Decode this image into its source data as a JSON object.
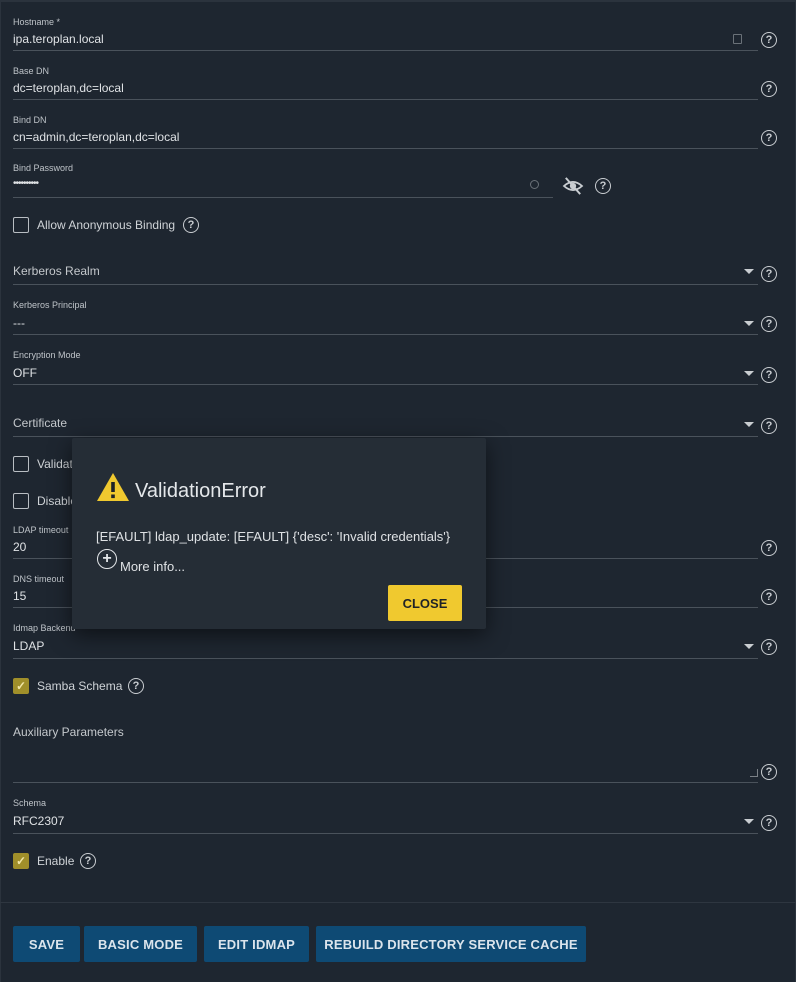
{
  "form": {
    "hostname": {
      "label": "Hostname *",
      "value": "ipa.teroplan.local"
    },
    "base_dn": {
      "label": "Base DN",
      "value": "dc=teroplan,dc=local"
    },
    "bind_dn": {
      "label": "Bind DN",
      "value": "cn=admin,dc=teroplan,dc=local"
    },
    "bind_password": {
      "label": "Bind Password",
      "value": "••••••••••"
    },
    "allow_anonymous": {
      "label": "Allow Anonymous Binding",
      "checked": false
    },
    "kerberos_realm": {
      "placeholder": "Kerberos Realm"
    },
    "kerberos_principal": {
      "label": "Kerberos Principal",
      "value": "---"
    },
    "encryption_mode": {
      "label": "Encryption Mode",
      "value": "OFF"
    },
    "certificate": {
      "placeholder": "Certificate"
    },
    "validate_certs": {
      "label": "Validat",
      "checked": false
    },
    "disable": {
      "label": "Disable",
      "checked": false
    },
    "ldap_timeout": {
      "label": "LDAP timeout",
      "value": "20"
    },
    "dns_timeout": {
      "label": "DNS timeout",
      "value": "15"
    },
    "idmap_backend": {
      "label": "Idmap Backend",
      "value": "LDAP"
    },
    "samba_schema": {
      "label": "Samba Schema",
      "checked": true
    },
    "auxiliary_parameters": {
      "label": "Auxiliary Parameters",
      "value": ""
    },
    "schema": {
      "label": "Schema",
      "value": "RFC2307"
    },
    "enable": {
      "label": "Enable",
      "checked": true
    }
  },
  "help_glyph": "?",
  "check_glyph": "✓",
  "buttons": {
    "save": "SAVE",
    "basic_mode": "BASIC MODE",
    "edit_idmap": "EDIT IDMAP",
    "rebuild_cache": "REBUILD DIRECTORY SERVICE CACHE"
  },
  "dialog": {
    "title": "ValidationError",
    "message": "[EFAULT] ldap_update: [EFAULT] {'desc': 'Invalid credentials'}",
    "more_info": "More info...",
    "plus_glyph": "+",
    "close": "CLOSE"
  },
  "colors": {
    "background": "#1e2630",
    "button": "#0e4a74",
    "accent": "#f0c92f",
    "checkbox_checked": "#a08f2a"
  },
  "icons": {
    "warning": "warning-icon",
    "visibility_off": "eye-off-icon",
    "help": "help-circle-icon",
    "dropdown": "chevron-down-icon",
    "expand": "plus-circle-icon"
  }
}
